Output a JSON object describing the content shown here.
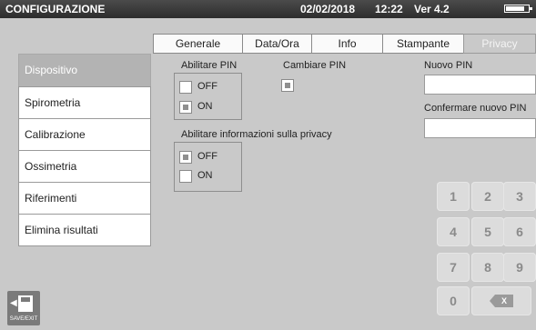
{
  "titlebar": {
    "title": "CONFIGURAZIONE",
    "date": "02/02/2018",
    "time": "12:22",
    "version": "Ver 4.2"
  },
  "tabs": [
    {
      "label": "Generale",
      "active": false
    },
    {
      "label": "Data/Ora",
      "active": false
    },
    {
      "label": "Info",
      "active": false
    },
    {
      "label": "Stampante",
      "active": false
    },
    {
      "label": "Privacy",
      "active": true
    }
  ],
  "sidebar": {
    "items": [
      {
        "label": "Dispositivo",
        "active": true
      },
      {
        "label": "Spirometria",
        "active": false
      },
      {
        "label": "Calibrazione",
        "active": false
      },
      {
        "label": "Ossimetria",
        "active": false
      },
      {
        "label": "Riferimenti",
        "active": false
      },
      {
        "label": "Elimina risultati",
        "active": false
      }
    ]
  },
  "privacy": {
    "enable_pin_label": "Abilitare PIN",
    "enable_pin_options": [
      {
        "label": "OFF",
        "checked": false
      },
      {
        "label": "ON",
        "checked": true
      }
    ],
    "change_pin_label": "Cambiare PIN",
    "change_pin_checked": true,
    "new_pin_label": "Nuovo PIN",
    "new_pin_value": "",
    "confirm_pin_label": "Confermare nuovo  PIN",
    "confirm_pin_value": "",
    "privacy_info_label": "Abilitare informazioni sulla privacy",
    "privacy_info_options": [
      {
        "label": "OFF",
        "checked": true
      },
      {
        "label": "ON",
        "checked": false
      }
    ]
  },
  "keypad": {
    "keys": [
      "1",
      "2",
      "3",
      "4",
      "5",
      "6",
      "7",
      "8",
      "9",
      "0"
    ],
    "delete_label": "X"
  },
  "save_exit_label": "SAVE/EXIT",
  "icons": {
    "save": "floppy-save-icon",
    "battery": "battery-icon",
    "delete": "backspace-icon"
  }
}
